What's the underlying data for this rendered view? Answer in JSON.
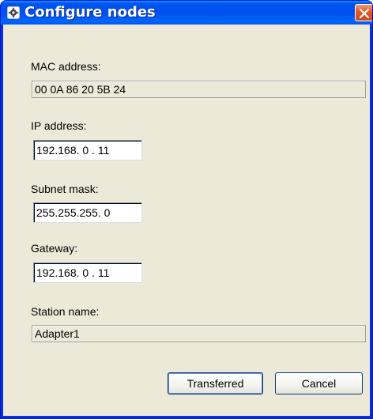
{
  "window": {
    "title": "Configure nodes",
    "title_icon": "app-icon",
    "close_icon": "close-icon"
  },
  "form": {
    "mac_label": "MAC address:",
    "mac_value": "00 0A 86 20 5B 24",
    "ip_label": "IP address:",
    "ip_value": "192.168.  0 . 11",
    "subnet_label": "Subnet mask:",
    "subnet_value": "255.255.255.  0",
    "gateway_label": "Gateway:",
    "gateway_value": "192.168.  0 . 11",
    "station_label": "Station name:",
    "station_value": "Adapter1"
  },
  "buttons": {
    "transferred": "Transferred",
    "cancel": "Cancel"
  },
  "colors": {
    "titlebar": "#0054e3",
    "client_bg": "#ece9d8",
    "close_button": "#e5592b"
  }
}
